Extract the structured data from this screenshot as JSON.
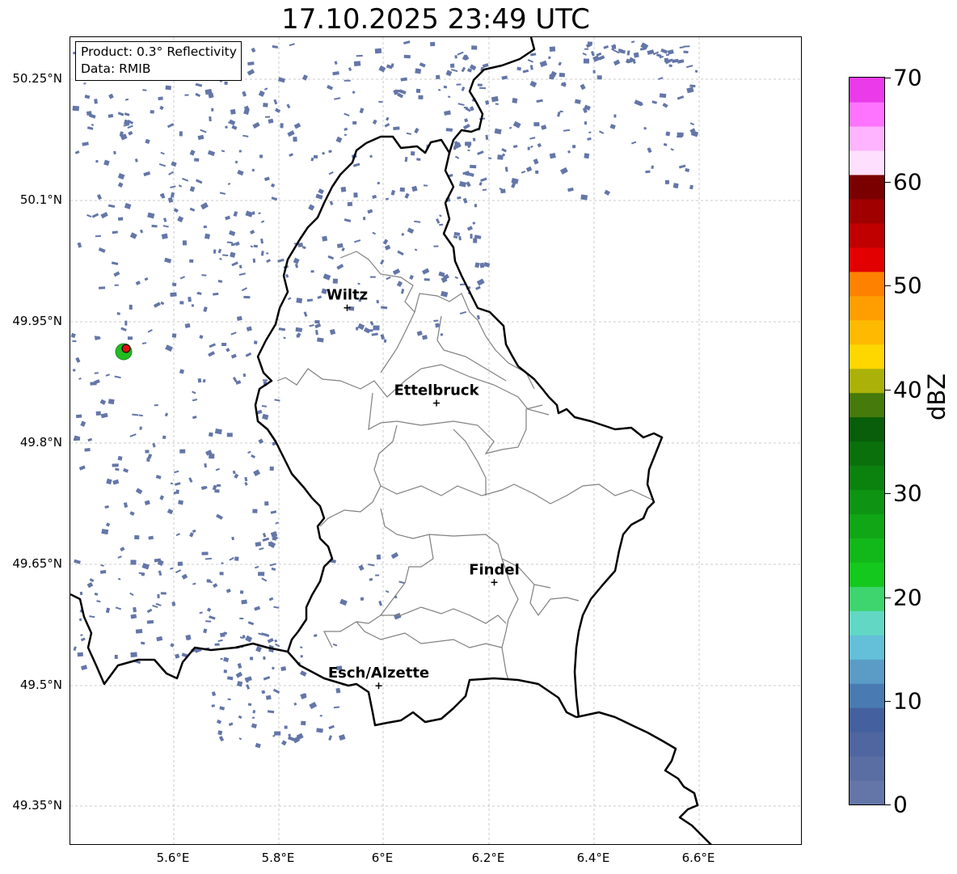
{
  "title": "17.10.2025 23:49 UTC",
  "info": {
    "product": "Product: 0.3° Reflectivity",
    "data": "Data: RMIB"
  },
  "axes": {
    "lat_ticks": [
      "50.25°N",
      "50.1°N",
      "49.95°N",
      "49.8°N",
      "49.65°N",
      "49.5°N",
      "49.35°N"
    ],
    "lon_ticks": [
      "5.6°E",
      "5.8°E",
      "6°E",
      "6.2°E",
      "6.4°E",
      "6.6°E"
    ],
    "lat_range": [
      49.3,
      50.3
    ],
    "lon_range": [
      5.4,
      6.79
    ]
  },
  "colorbar": {
    "label": "dBZ",
    "ticks": [
      "0",
      "10",
      "20",
      "30",
      "40",
      "50",
      "60",
      "70"
    ],
    "min": 0,
    "max": 70,
    "step": 2.5,
    "colors": [
      "#6476a8",
      "#5a6ea3",
      "#4f66a0",
      "#45609f",
      "#4a7ab2",
      "#5a9cc6",
      "#64c0d8",
      "#62d8c4",
      "#3ed46e",
      "#14c81e",
      "#12b81a",
      "#10a616",
      "#0e9412",
      "#0c820e",
      "#0a700c",
      "#085e0a",
      "#467a0c",
      "#aab20a",
      "#fed600",
      "#feba00",
      "#fe9e00",
      "#fe8200",
      "#e20000",
      "#c00000",
      "#a00000",
      "#7a0000",
      "#fee0fe",
      "#feb4fe",
      "#fe74fe",
      "#ea3aea"
    ]
  },
  "cities": [
    {
      "name": "Wiltz",
      "lon": 5.93,
      "lat": 49.967
    },
    {
      "name": "Ettelbruck",
      "lon": 6.1,
      "lat": 49.849
    },
    {
      "name": "Findel",
      "lon": 6.21,
      "lat": 49.627
    },
    {
      "name": "Esch/Alzette",
      "lon": 5.99,
      "lat": 49.499
    }
  ],
  "colors": {
    "echo": "#6476a8",
    "country_border": "#000000",
    "canton_border": "#808080",
    "grid": "#bbbbbb"
  }
}
